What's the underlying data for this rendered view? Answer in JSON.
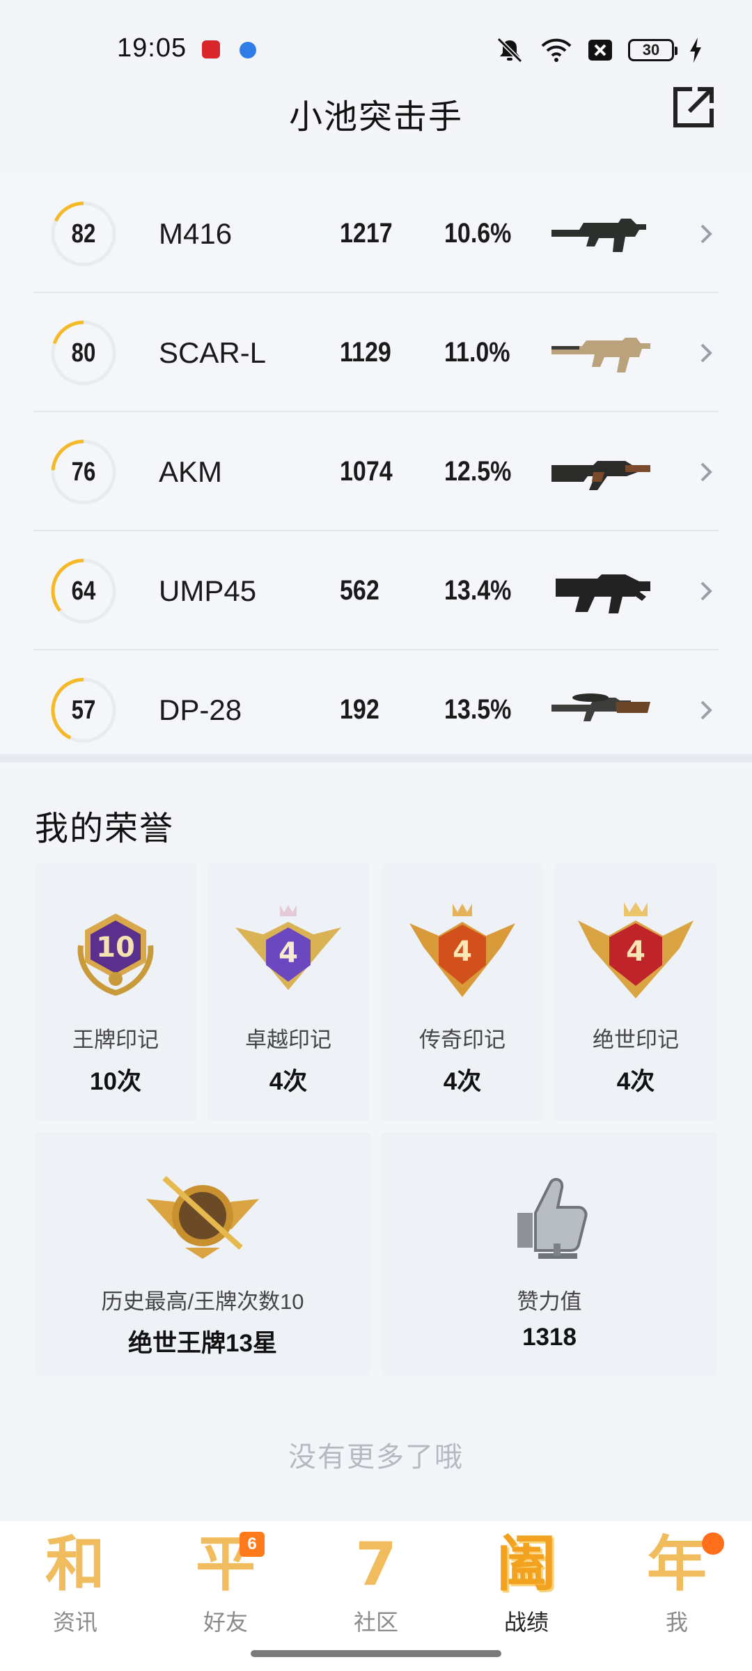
{
  "status_bar": {
    "time": "19:05",
    "battery": "30",
    "icons": [
      "app-notification-icon",
      "browser-icon",
      "mute-icon",
      "wifi-icon",
      "sim-off-icon",
      "battery-icon",
      "charging-icon"
    ]
  },
  "header": {
    "title": "小池突击手",
    "share_icon": "share-icon"
  },
  "weapons": [
    {
      "score": "82",
      "score_value": 82,
      "name": "M416",
      "kills": "1217",
      "rate": "10.6%",
      "icon": "m416-rifle-icon"
    },
    {
      "score": "80",
      "score_value": 80,
      "name": "SCAR-L",
      "kills": "1129",
      "rate": "11.0%",
      "icon": "scar-l-rifle-icon"
    },
    {
      "score": "76",
      "score_value": 76,
      "name": "AKM",
      "kills": "1074",
      "rate": "12.5%",
      "icon": "akm-rifle-icon"
    },
    {
      "score": "64",
      "score_value": 64,
      "name": "UMP45",
      "kills": "562",
      "rate": "13.4%",
      "icon": "ump45-smg-icon"
    },
    {
      "score": "57",
      "score_value": 57,
      "name": "DP-28",
      "kills": "192",
      "rate": "13.5%",
      "icon": "dp28-lmg-icon"
    }
  ],
  "honors": {
    "title": "我的荣誉",
    "marks": [
      {
        "label": "王牌印记",
        "count": "10次",
        "badge_text": "10",
        "color": "#6a3d9a"
      },
      {
        "label": "卓越印记",
        "count": "4次",
        "badge_text": "4",
        "color": "#7b4bc4"
      },
      {
        "label": "传奇印记",
        "count": "4次",
        "badge_text": "4",
        "color": "#d4561e"
      },
      {
        "label": "绝世印记",
        "count": "4次",
        "badge_text": "4",
        "color": "#c92a2a"
      }
    ],
    "highest": {
      "label": "历史最高/王牌次数10",
      "value": "绝世王牌13星"
    },
    "likes": {
      "label": "赞力值",
      "value": "1318"
    }
  },
  "no_more": "没有更多了哦",
  "tabs": [
    {
      "glyph": "和",
      "label": "资讯",
      "active": false
    },
    {
      "glyph": "平",
      "label": "好友",
      "active": false,
      "badge": "6"
    },
    {
      "glyph": "7",
      "label": "社区",
      "active": false
    },
    {
      "glyph": "阖",
      "label": "战绩",
      "active": true
    },
    {
      "glyph": "年",
      "label": "我",
      "active": false,
      "dot": true
    }
  ],
  "colors": {
    "ring_active": "#f5b928",
    "ring_track": "#e8ebf0",
    "tab_gold": "#f0bc5e",
    "badge_orange": "#ff7a1a"
  }
}
